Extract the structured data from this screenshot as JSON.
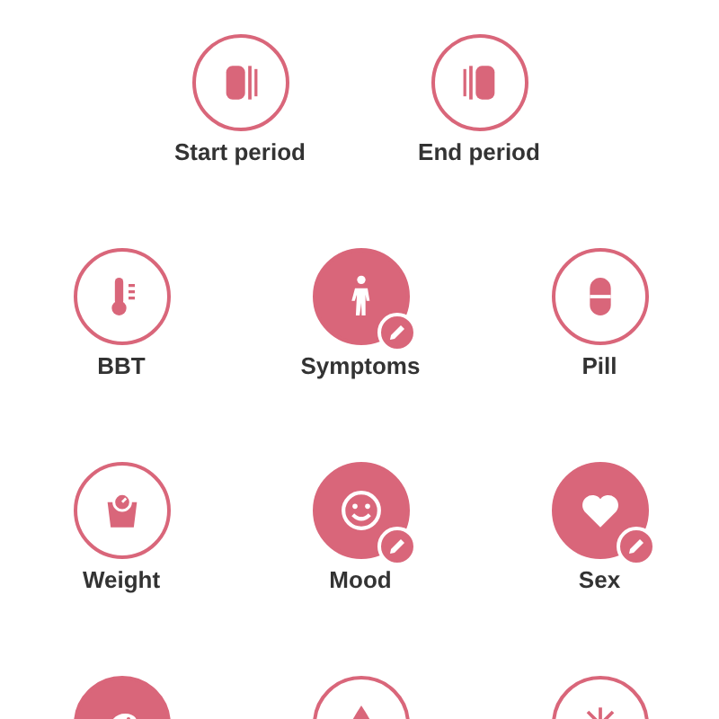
{
  "top_actions": [
    {
      "label": "Start period",
      "kind": "start",
      "logged": false,
      "edit_badge": false
    },
    {
      "label": "End period",
      "kind": "end",
      "logged": false,
      "edit_badge": false
    }
  ],
  "trackers": [
    {
      "label": "BBT",
      "kind": "thermometer",
      "logged": false,
      "edit_badge": false
    },
    {
      "label": "Symptoms",
      "kind": "figure",
      "logged": true,
      "edit_badge": true
    },
    {
      "label": "Pill",
      "kind": "pill",
      "logged": false,
      "edit_badge": false
    },
    {
      "label": "Weight",
      "kind": "scale",
      "logged": false,
      "edit_badge": false
    },
    {
      "label": "Mood",
      "kind": "smiley",
      "logged": true,
      "edit_badge": true
    },
    {
      "label": "Sex",
      "kind": "heart",
      "logged": true,
      "edit_badge": true
    },
    {
      "kind": "bird",
      "logged": true
    },
    {
      "kind": "drop",
      "logged": false
    },
    {
      "kind": "burst",
      "logged": false
    }
  ]
}
